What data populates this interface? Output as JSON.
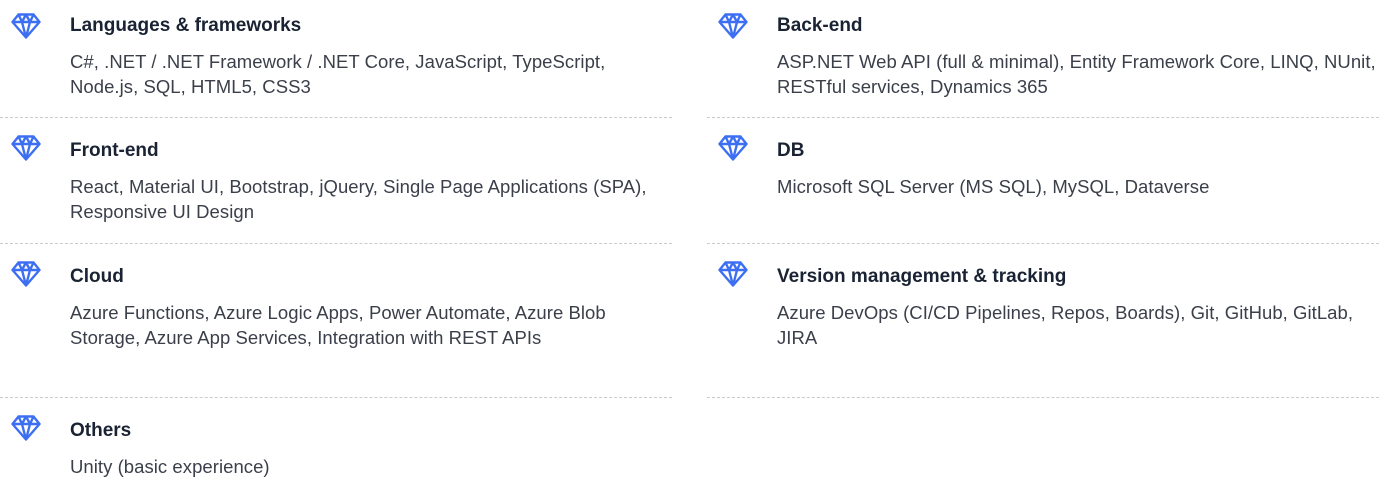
{
  "skills_left": [
    {
      "title": "Languages & frameworks",
      "description": "C#, .NET / .NET Framework / .NET Core, JavaScript, TypeScript, Node.js, SQL, HTML5, CSS3",
      "icon": "gem-icon"
    },
    {
      "title": "Front-end",
      "description": "React, Material UI, Bootstrap, jQuery, Single Page Applications (SPA), Responsive UI Design",
      "icon": "gem-icon"
    },
    {
      "title": "Cloud",
      "description": "Azure Functions, Azure Logic Apps, Power Automate, Azure Blob Storage, Azure App Services, Integration with REST APIs",
      "icon": "gem-icon"
    },
    {
      "title": "Others",
      "description": "Unity (basic experience)",
      "icon": "gem-icon"
    }
  ],
  "skills_right": [
    {
      "title": "Back-end",
      "description": "ASP.NET Web API (full & minimal), Entity Framework Core, LINQ, NUnit, RESTful services, Dynamics 365",
      "icon": "gem-icon"
    },
    {
      "title": "DB",
      "description": "Microsoft SQL Server (MS SQL), MySQL, Dataverse",
      "icon": "gem-icon"
    },
    {
      "title": "Version management & tracking",
      "description": "Azure DevOps (CI/CD Pipelines, Repos, Boards), Git, GitHub, GitLab, JIRA",
      "icon": "gem-icon"
    }
  ],
  "colors": {
    "accent": "#3d6ff2",
    "title": "#1a2333",
    "text": "#3a3f4a",
    "divider": "#c9cbd0"
  }
}
